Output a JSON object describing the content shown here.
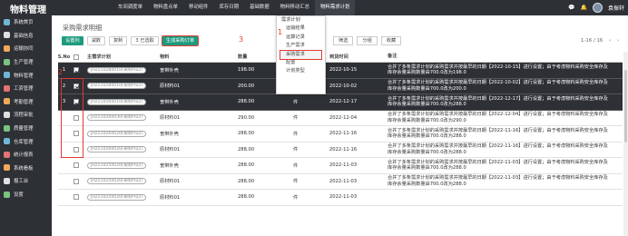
{
  "app_title": "物料管理",
  "nav": [
    "车间调度单",
    "物料盘点单",
    "移动组件",
    "库存日期",
    "基础数据",
    "物料移动汇总",
    "物料需求计划"
  ],
  "user": "袁振轩",
  "sidebar": [
    "系统首页",
    "基础信息",
    "运输协同",
    "生产管理",
    "物料管理",
    "工资管理",
    "考勤管理",
    "流程审批",
    "质量管理",
    "仓库管理",
    "统计报表",
    "系统看板",
    "报工台",
    "设置"
  ],
  "page_title": "采购需求明细",
  "toolbar": {
    "submit": "设置列",
    "reduce": "减数",
    "copy": "复制",
    "selected": "3 已选取",
    "generate": "生成采购订单"
  },
  "filters": {
    "filter": "筛选",
    "group": "分组",
    "fav": "收藏"
  },
  "pager": {
    "range": "1-16 / 16",
    "prev": "‹",
    "next": "›"
  },
  "menu": {
    "header": "需求计划",
    "items": [
      "运输结果",
      "运算记录",
      "生产需求",
      "采购需求",
      "配置",
      "计划类型"
    ],
    "active_index": 3
  },
  "annotations": {
    "a1": "1",
    "a2": "2",
    "a3": "3"
  },
  "columns": {
    "no": "S.No",
    "plan": "主需求计划",
    "material": "物料",
    "qty": "数量",
    "unit": "位",
    "date": "到货时间",
    "note": "备注"
  },
  "rows": [
    {
      "no": "1",
      "checked": true,
      "plan": "JH2210280010(采购Pro2)",
      "material": "宽带外壳",
      "qty": "198.00",
      "unit": "件",
      "date": "2022-10-15",
      "note": "合并了多条需求计划的采购需求并按最早的日期【2022-10-15】进行设置；由于考虑物料采购安全库存及库存余量采购数量由700.0改为198.0",
      "selected": true
    },
    {
      "no": "2",
      "checked": true,
      "plan": "JH2210280010(采购Pro2)",
      "material": "原材料01",
      "qty": "200.00",
      "unit": "件",
      "date": "2022-10-02",
      "note": "合并了多条需求计划的采购需求并按最早的日期【2022-10-02】进行设置；由于考虑物料采购安全库存及库存余量采购数量由700.0改为200.0",
      "selected": true
    },
    {
      "no": "3",
      "checked": true,
      "plan": "JH2210260010(采购Pro2)",
      "material": "宽带外壳",
      "qty": "288.00",
      "unit": "件",
      "date": "2022-12-17",
      "note": "合并了多条需求计划的采购需求并按最早的日期【2022-12-17】进行设置；由于考虑物料采购安全库存及库存余量采购数量由700.0改为288.0",
      "selected": true
    },
    {
      "no": "",
      "checked": false,
      "plan": "JH2210260030(采购Pro2)",
      "material": "原材料01",
      "qty": "290.00",
      "unit": "件",
      "date": "2022-12-04",
      "note": "合并了多条需求计划的采购需求并按最早的日期【2022-12-04】进行设置；由于考虑物料采购安全库存及库存余量采购数量由700.0改为290.0",
      "selected": false
    },
    {
      "no": "",
      "checked": false,
      "plan": "JH2210260020(采购Pro2)",
      "material": "宽带外壳",
      "qty": "288.00",
      "unit": "件",
      "date": "2022-11-16",
      "note": "合并了多条需求计划的采购需求并按最早的日期【2022-11-16】进行设置；由于考虑物料采购安全库存及库存余量采购数量由700.0改为288.0",
      "selected": false
    },
    {
      "no": "",
      "checked": false,
      "plan": "JH2210260020(采购Pro2)",
      "material": "原材料01",
      "qty": "288.00",
      "unit": "件",
      "date": "2022-11-16",
      "note": "合并了多条需求计划的采购需求并按最早的日期【2022-11-16】进行设置；由于考虑物料采购安全库存及库存余量采购数量由700.0改为288.0",
      "selected": false
    },
    {
      "no": "",
      "checked": false,
      "plan": "JH2210250020(采购Pro2)",
      "material": "宽带外壳",
      "qty": "288.00",
      "unit": "件",
      "date": "2022-11-03",
      "note": "合并了多条需求计划的采购需求并按最早的日期【2022-11-03】进行设置；由于考虑物料采购安全库存及库存余量采购数量由700.0改为288.0",
      "selected": false
    },
    {
      "no": "",
      "checked": false,
      "plan": "JH2210250020(采购Pro2)",
      "material": "原材料01",
      "qty": "288.00",
      "unit": "件",
      "date": "2022-11-03",
      "note": "合并了多条需求计划的采购需求并按最早的日期【2022-11-03】进行设置；由于考虑物料采购安全库存及库存余量采购数量由700.0改为288.0",
      "selected": false
    },
    {
      "no": "",
      "checked": false,
      "plan": "JH2210250020(采购Pro2)",
      "material": "原材料01",
      "qty": "288.00",
      "unit": "件",
      "date": "2022-11-03",
      "note": "",
      "selected": false
    }
  ]
}
